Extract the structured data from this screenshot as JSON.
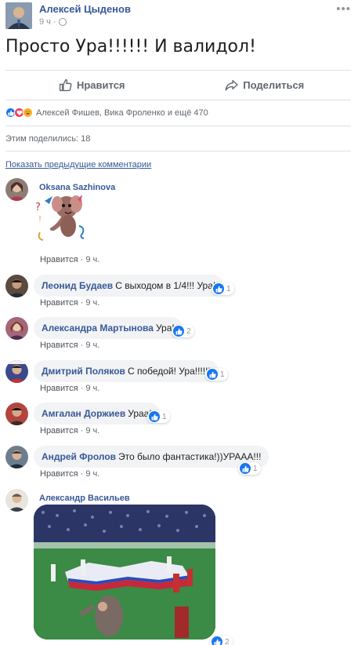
{
  "post": {
    "author": "Алексей Цыденов",
    "time": "9 ч",
    "time_sep": "·",
    "more_glyph": "•••",
    "text": "Просто Ура!!!!!! И валидол!"
  },
  "actions": {
    "like_label": "Нравится",
    "share_label": "Поделиться"
  },
  "reactions": {
    "summary": "Алексей Фишев, Вика Фроленко и ещё 470",
    "types": [
      "like",
      "love",
      "haha"
    ],
    "colors": {
      "like": "#1877f2",
      "love": "#f33e58",
      "haha": "#f7b125"
    }
  },
  "shares_text": "Этим поделились: 18",
  "prev_comments_link": "Показать предыдущие комментарии",
  "comments": [
    {
      "name": "Oksana Sazhinova",
      "text": "",
      "like": "Нравится",
      "sep": "·",
      "time": "9 ч.",
      "reactions": ""
    },
    {
      "name": "Леонид Будаев",
      "text": "С выходом в 1/4!!! Ура!",
      "like": "Нравится",
      "sep": "·",
      "time": "9 ч.",
      "reactions": "1"
    },
    {
      "name": "Александра Мартынова",
      "text": "Ура!",
      "like": "Нравится",
      "sep": "·",
      "time": "9 ч.",
      "reactions": "2"
    },
    {
      "name": "Дмитрий Поляков",
      "text": "С победой! Ура!!!!!!",
      "like": "Нравится",
      "sep": "·",
      "time": "9 ч.",
      "reactions": "1"
    },
    {
      "name": "Амгалан Доржиев",
      "text": "Ураа!",
      "like": "Нравится",
      "sep": "·",
      "time": "9 ч.",
      "reactions": "1"
    },
    {
      "name": "Андрей Фролов",
      "text": "Это было фантастика!))УРААА!!!",
      "like": "Нравится",
      "sep": "·",
      "time": "9 ч.",
      "reactions": "1"
    },
    {
      "name": "Александр Васильев",
      "text": "",
      "like": "",
      "sep": "",
      "time": "",
      "reactions": "2"
    }
  ]
}
